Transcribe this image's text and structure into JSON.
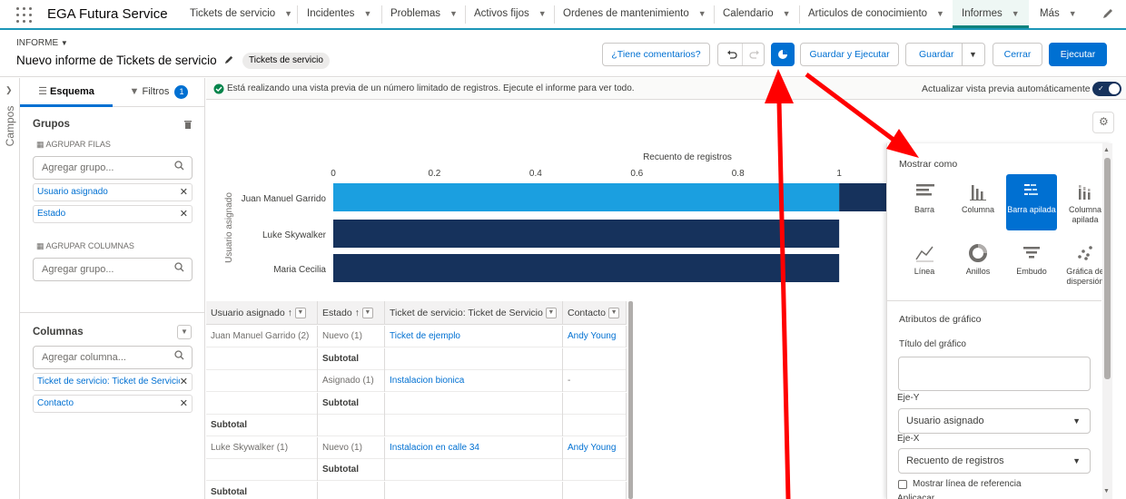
{
  "nav": {
    "app_name": "EGA Futura Service",
    "tabs": [
      "Tickets de servicio",
      "Incidentes",
      "Problemas",
      "Activos fijos",
      "Ordenes de mantenimiento",
      "Calendario",
      "Articulos de conocimiento",
      "Informes",
      "Más"
    ],
    "active_tab": "Informes"
  },
  "header": {
    "object_type": "INFORME",
    "title": "Nuevo informe de Tickets de servicio",
    "report_type_badge": "Tickets de servicio",
    "feedback_button": "¿Tiene comentarios?",
    "save_run_button": "Guardar y Ejecutar",
    "save_button": "Guardar",
    "close_button": "Cerrar",
    "run_button": "Ejecutar"
  },
  "rail": {
    "label": "Campos"
  },
  "panel": {
    "tabs": {
      "outline": "Esquema",
      "filters": "Filtros",
      "filters_count": "1"
    },
    "groups": {
      "title": "Grupos",
      "rows_label": "AGRUPAR FILAS",
      "rows_placeholder": "Agregar grupo...",
      "rows": [
        "Usuario asignado",
        "Estado"
      ],
      "cols_label": "AGRUPAR COLUMNAS",
      "cols_placeholder": "Agregar grupo..."
    },
    "columns": {
      "title": "Columnas",
      "placeholder": "Agregar columna...",
      "items": [
        "Ticket de servicio: Ticket de Servicio",
        "Contacto"
      ]
    }
  },
  "preview": {
    "notice": "Está realizando una vista previa de un número limitado de registros. Ejecute el informe para ver todo.",
    "auto_preview_label": "Actualizar vista previa automáticamente"
  },
  "chart_data": {
    "type": "bar",
    "orientation": "horizontal",
    "stacked": true,
    "title": "",
    "xlabel": "Recuento de registros",
    "ylabel": "Usuario asignado",
    "xlim": [
      0,
      1.4
    ],
    "xticks": [
      "0",
      "0.2",
      "0.4",
      "0.6",
      "0.8",
      "1",
      "1.2",
      "1.4"
    ],
    "categories": [
      "Juan Manuel Garrido",
      "Luke Skywalker",
      "Maria Cecilia"
    ],
    "series": [
      {
        "values": [
          1,
          0,
          0
        ],
        "color": "#1b9fe0"
      },
      {
        "values": [
          1,
          1,
          1
        ],
        "color": "#16325c"
      }
    ]
  },
  "table": {
    "headers": [
      "Usuario asignado",
      "Estado",
      "Ticket de servicio: Ticket de Servicio",
      "Contacto"
    ],
    "rows": [
      {
        "user": "Juan Manuel Garrido (2)",
        "estado": "Nuevo (1)",
        "ticket": "Ticket de ejemplo",
        "contacto": "Andy Young"
      },
      {
        "user": "",
        "estado": "Subtotal",
        "ticket": "",
        "contacto": ""
      },
      {
        "user": "",
        "estado": "Asignado (1)",
        "ticket": "Instalacion bionica",
        "contacto": "-"
      },
      {
        "user": "",
        "estado": "Subtotal",
        "ticket": "",
        "contacto": ""
      },
      {
        "user": "Subtotal",
        "estado": "",
        "ticket": "",
        "contacto": ""
      },
      {
        "user": "Luke Skywalker (1)",
        "estado": "Nuevo (1)",
        "ticket": "Instalacion en calle 34",
        "contacto": "Andy Young"
      },
      {
        "user": "",
        "estado": "Subtotal",
        "ticket": "",
        "contacto": ""
      },
      {
        "user": "Subtotal",
        "estado": "",
        "ticket": "",
        "contacto": ""
      }
    ]
  },
  "chart_panel": {
    "display_as": "Mostrar como",
    "types": [
      {
        "label": "Barra",
        "icon": "bar-chart-icon"
      },
      {
        "label": "Columna",
        "icon": "column-chart-icon"
      },
      {
        "label": "Barra apilada",
        "icon": "stacked-bar-icon",
        "selected": true
      },
      {
        "label": "Columna apilada",
        "icon": "stacked-column-icon"
      },
      {
        "label": "Línea",
        "icon": "line-chart-icon"
      },
      {
        "label": "Anillos",
        "icon": "donut-chart-icon"
      },
      {
        "label": "Embudo",
        "icon": "funnel-chart-icon"
      },
      {
        "label": "Gráfica de dispersión",
        "icon": "scatter-chart-icon"
      }
    ],
    "attributes_title": "Atributos de gráfico",
    "chart_title_label": "Título del gráfico",
    "chart_title_value": "",
    "y_axis_label": "Eje-Y",
    "y_axis_value": "Usuario asignado",
    "x_axis_label": "Eje-X",
    "x_axis_value": "Recuento de registros",
    "ref_line_label": "Mostrar línea de referencia",
    "cut_label": "Aplicacar"
  },
  "colors": {
    "brand": "#0070d2",
    "nav_accent": "#1b96b8",
    "arrow": "#ff0000",
    "bar_dark": "#16325c",
    "bar_light": "#1b9fe0"
  }
}
